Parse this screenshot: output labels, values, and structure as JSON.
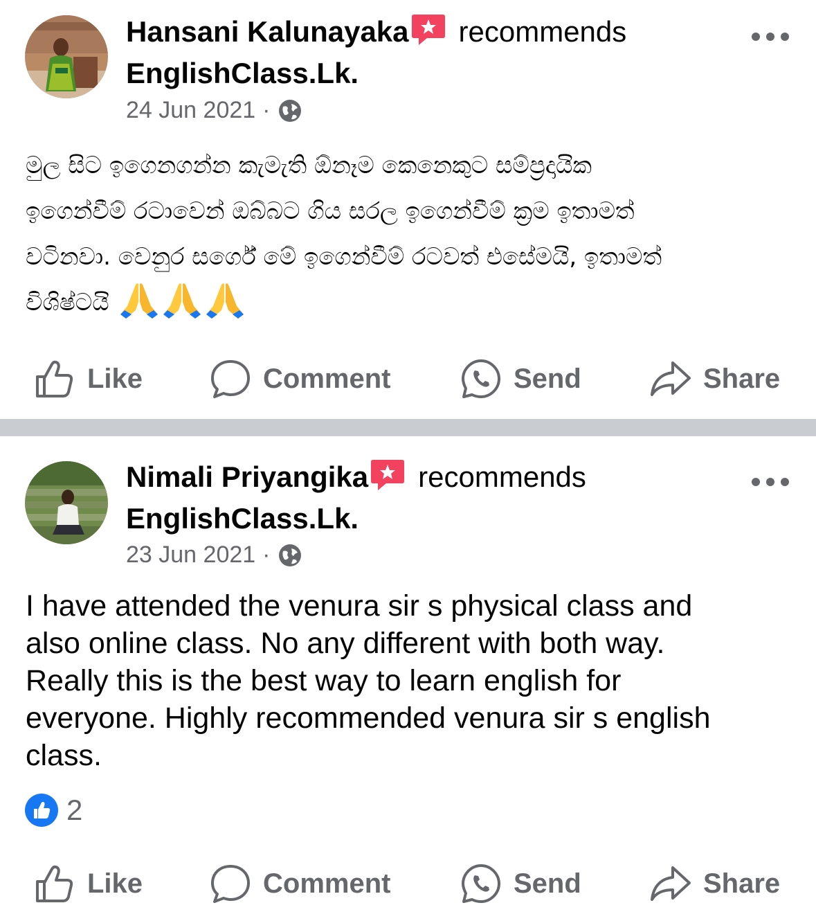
{
  "posts": [
    {
      "author": "Hansani Kalunayaka",
      "verb": "recommends",
      "page": "EnglishClass.Lk.",
      "date": "24 Jun 2021",
      "separator": "·",
      "privacy_icon": "globe-icon",
      "body": "මුල සිට ඉගෙනගන්න කැමැති ඕනෑම කෙනෙකුට සම්ප්‍රදායික\nඉගෙන්වීම් රටාවෙන් ඔබ්බට ගිය සරල ඉගෙන්වීම් ක්‍රම ඉතාමත්\nවටිනවා. වෙනුර සර්ගේ මේ ඉගෙන්වීම් රටවත්  එසේමයි, ඉතාමත්\nවිශිෂ්ටයි",
      "emojis": [
        "folded-hands",
        "folded-hands",
        "folded-hands"
      ],
      "reaction_count": null
    },
    {
      "author": "Nimali Priyangika",
      "verb": "recommends",
      "page": "EnglishClass.Lk.",
      "date": "23 Jun 2021",
      "separator": "·",
      "privacy_icon": "globe-icon",
      "body": "I have attended the venura sir s physical class and\nalso online class. No any different with both way.\nReally this is the best way to learn english for\neveryone. Highly recommended venura sir s english\nclass.",
      "emojis": [],
      "reaction_count": "2"
    }
  ],
  "actions": {
    "like": "Like",
    "comment": "Comment",
    "send": "Send",
    "share": "Share"
  },
  "colors": {
    "accent": "#1877f2",
    "recommend_badge": "#f3425f",
    "secondary_text": "#65676b",
    "divider": "#c9ccd1"
  }
}
